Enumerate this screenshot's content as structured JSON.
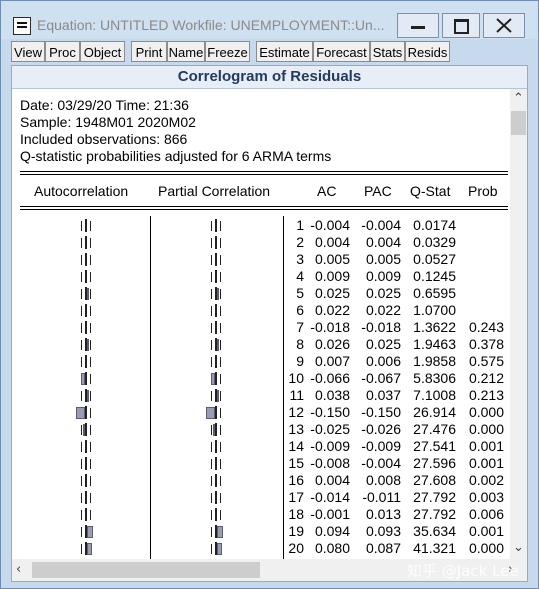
{
  "window": {
    "title": "Equation: UNTITLED   Workfile: UNEMPLOYMENT::Un..."
  },
  "toolbar": {
    "buttons": [
      "View",
      "Proc",
      "Object",
      "Print",
      "Name",
      "Freeze",
      "Estimate",
      "Forecast",
      "Stats",
      "Resids"
    ]
  },
  "view": {
    "title": "Correlogram of Residuals",
    "info": {
      "date": "Date: 03/29/20   Time: 21:36",
      "sample": "Sample: 1948M01 2020M02",
      "obs": "Included observations: 866",
      "note": "Q-statistic probabilities adjusted for 6 ARMA terms"
    },
    "headers": {
      "autocorrelation": "Autocorrelation",
      "partial": "Partial Correlation",
      "ac": "AC",
      "pac": "PAC",
      "qstat": "Q-Stat",
      "prob": "Prob"
    },
    "rows": [
      {
        "lag": "1",
        "ac": "-0.004",
        "pac": "-0.004",
        "q": "0.0174",
        "prob": ""
      },
      {
        "lag": "2",
        "ac": "0.004",
        "pac": "0.004",
        "q": "0.0329",
        "prob": ""
      },
      {
        "lag": "3",
        "ac": "0.005",
        "pac": "0.005",
        "q": "0.0527",
        "prob": ""
      },
      {
        "lag": "4",
        "ac": "0.009",
        "pac": "0.009",
        "q": "0.1245",
        "prob": ""
      },
      {
        "lag": "5",
        "ac": "0.025",
        "pac": "0.025",
        "q": "0.6595",
        "prob": ""
      },
      {
        "lag": "6",
        "ac": "0.022",
        "pac": "0.022",
        "q": "1.0700",
        "prob": ""
      },
      {
        "lag": "7",
        "ac": "-0.018",
        "pac": "-0.018",
        "q": "1.3622",
        "prob": "0.243"
      },
      {
        "lag": "8",
        "ac": "0.026",
        "pac": "0.025",
        "q": "1.9463",
        "prob": "0.378"
      },
      {
        "lag": "9",
        "ac": "0.007",
        "pac": "0.006",
        "q": "1.9858",
        "prob": "0.575"
      },
      {
        "lag": "10",
        "ac": "-0.066",
        "pac": "-0.067",
        "q": "5.8306",
        "prob": "0.212"
      },
      {
        "lag": "11",
        "ac": "0.038",
        "pac": "0.037",
        "q": "7.1008",
        "prob": "0.213"
      },
      {
        "lag": "12",
        "ac": "-0.150",
        "pac": "-0.150",
        "q": "26.914",
        "prob": "0.000"
      },
      {
        "lag": "13",
        "ac": "-0.025",
        "pac": "-0.026",
        "q": "27.476",
        "prob": "0.000"
      },
      {
        "lag": "14",
        "ac": "-0.009",
        "pac": "-0.009",
        "q": "27.541",
        "prob": "0.001"
      },
      {
        "lag": "15",
        "ac": "-0.008",
        "pac": "-0.004",
        "q": "27.596",
        "prob": "0.001"
      },
      {
        "lag": "16",
        "ac": "0.004",
        "pac": "0.008",
        "q": "27.608",
        "prob": "0.002"
      },
      {
        "lag": "17",
        "ac": "-0.014",
        "pac": "-0.011",
        "q": "27.792",
        "prob": "0.003"
      },
      {
        "lag": "18",
        "ac": "-0.001",
        "pac": "0.013",
        "q": "27.792",
        "prob": "0.006"
      },
      {
        "lag": "19",
        "ac": "0.094",
        "pac": "0.093",
        "q": "35.634",
        "prob": "0.001"
      },
      {
        "lag": "20",
        "ac": "0.080",
        "pac": "0.087",
        "q": "41.321",
        "prob": "0.000"
      }
    ]
  },
  "watermark": "知乎 @Jack Lee"
}
